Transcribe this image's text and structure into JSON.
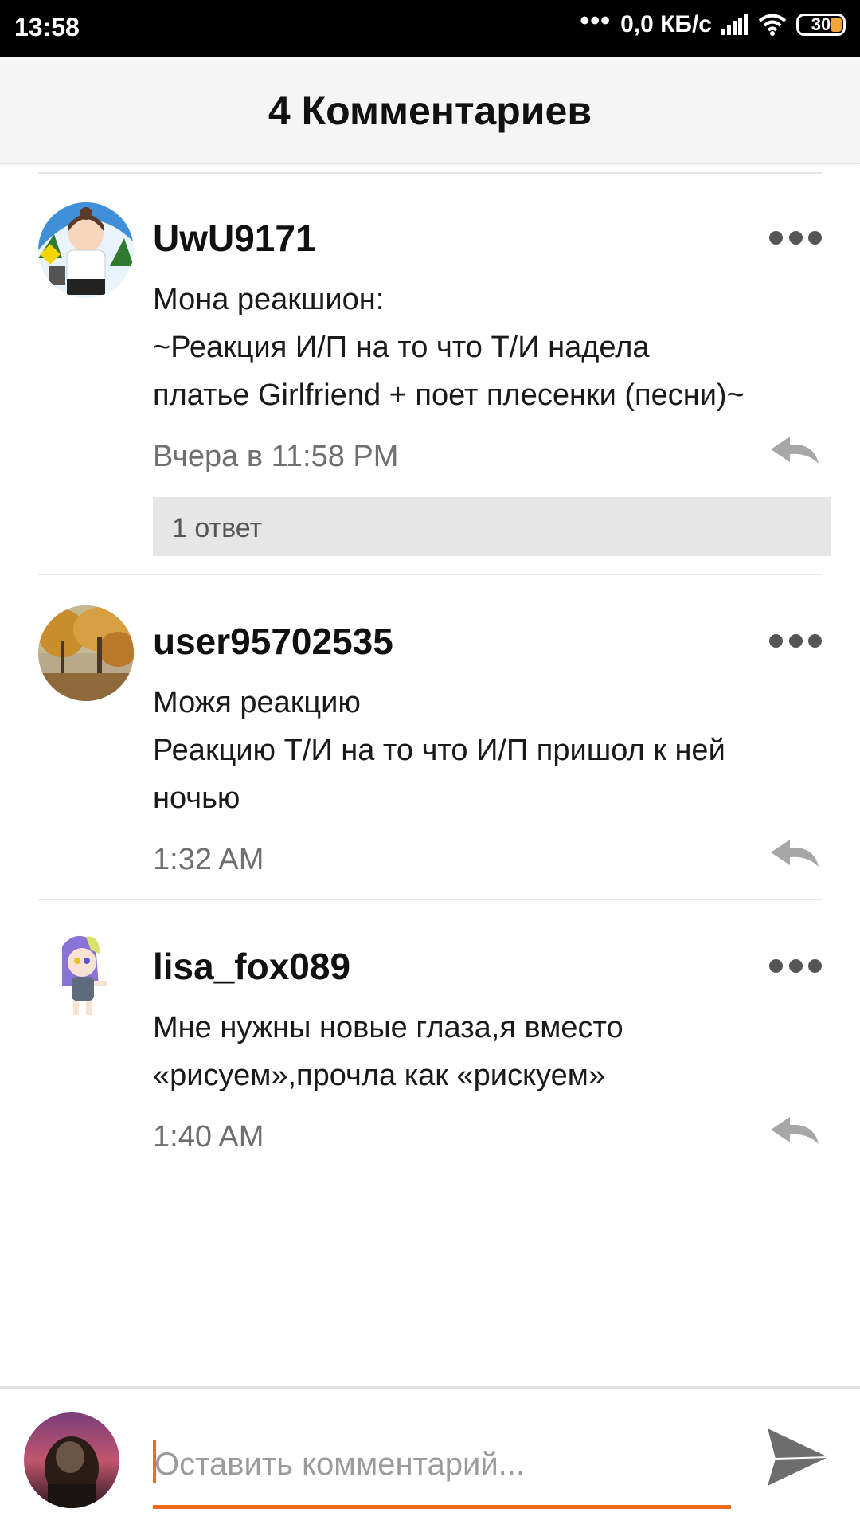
{
  "status_bar": {
    "time": "13:58",
    "dots": "•••",
    "speed": "0,0 КБ/с",
    "battery": "30"
  },
  "header": {
    "title": "4 Комментариев"
  },
  "comments": [
    {
      "username": "UwU9171",
      "lines": [
        "Мона реакшион:",
        "~Реакция И/П на то что Т/И надела",
        "платье Girlfriend + поет плесенки (песни)~"
      ],
      "time": "Вчера в 11:58 PM",
      "replies": "1 ответ"
    },
    {
      "username": "user95702535",
      "lines": [
        "Можя реакцию",
        "Реакцию Т/И  на то что И/П пришол к ней",
        "ночью"
      ],
      "time": "1:32 AM"
    },
    {
      "username": "lisa_fox089",
      "lines": [
        "Мне нужны новые глаза,я вместо",
        "«рисуем»,прочла как «рискуем»"
      ],
      "time": "1:40 AM"
    }
  ],
  "footer": {
    "placeholder": "Оставить комментарий..."
  },
  "colors": {
    "accent": "#f06a1d",
    "header_bg": "#f5f5f5",
    "replies_bg": "#e6e6e6"
  },
  "icons": [
    "more-icon",
    "reply-icon",
    "send-icon",
    "wifi-icon",
    "signal-icon",
    "battery-icon"
  ]
}
